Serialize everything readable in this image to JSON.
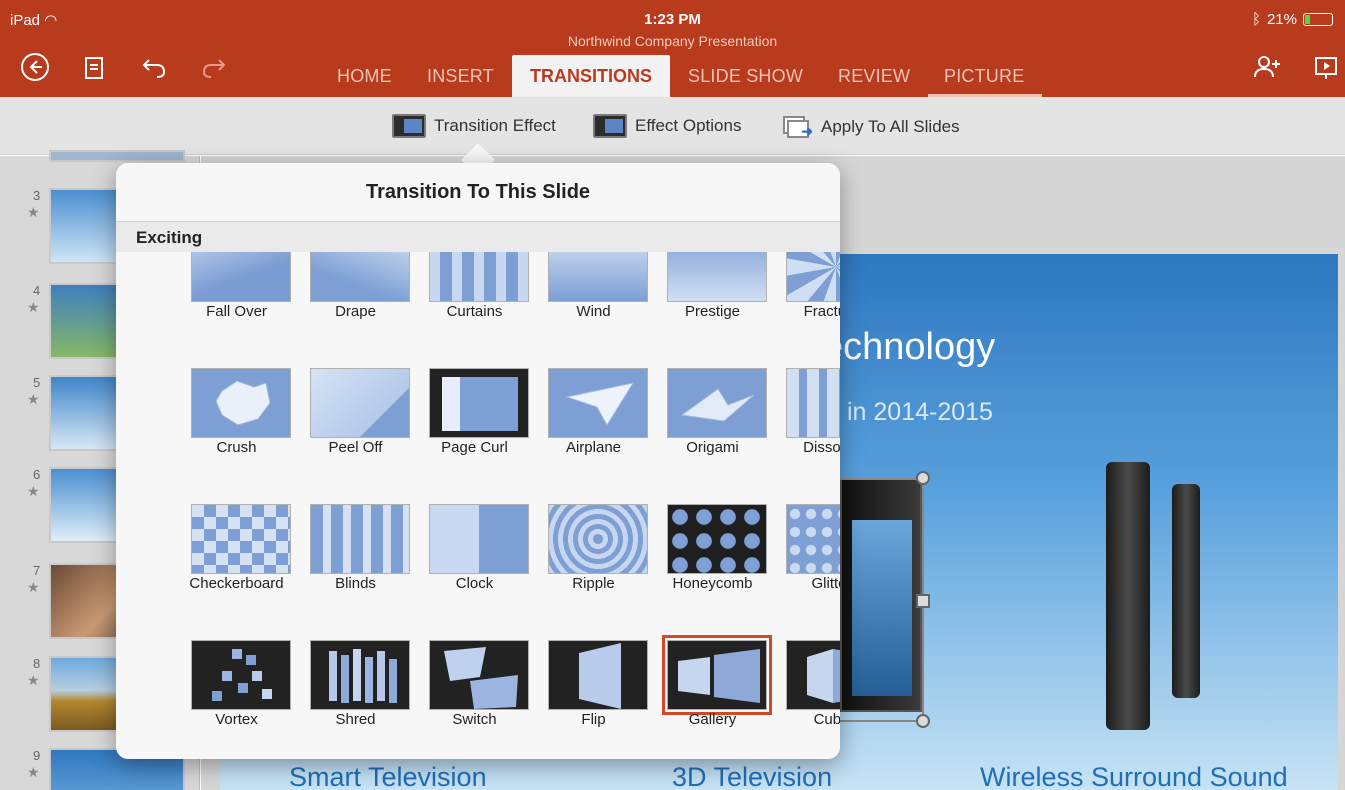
{
  "status": {
    "device": "iPad",
    "time": "1:23 PM",
    "battery": "21%",
    "battery_level": 0.21
  },
  "document": {
    "title": "Northwind Company Presentation"
  },
  "toolbar": {
    "back_icon": "back-circle-icon",
    "file_icon": "file-icon",
    "undo_icon": "undo-icon",
    "redo_icon": "redo-icon",
    "share_icon": "add-person-icon",
    "present_icon": "present-icon"
  },
  "tabs": [
    {
      "label": "HOME"
    },
    {
      "label": "INSERT"
    },
    {
      "label": "TRANSITIONS",
      "active": true
    },
    {
      "label": "SLIDE SHOW"
    },
    {
      "label": "REVIEW"
    },
    {
      "label": "PICTURE"
    }
  ],
  "ribbon": {
    "transition_effect": "Transition Effect",
    "effect_options": "Effect Options",
    "apply_all": "Apply To All Slides"
  },
  "slides": [
    {
      "number": "3"
    },
    {
      "number": "4"
    },
    {
      "number": "5"
    },
    {
      "number": "6"
    },
    {
      "number": "7"
    },
    {
      "number": "8"
    },
    {
      "number": "9"
    }
  ],
  "slide": {
    "title": "echnology",
    "subtitle": "in 2014-2015",
    "captions": [
      "Smart Television",
      "3D Television",
      "Wireless Surround Sound"
    ]
  },
  "popover": {
    "title": "Transition To This Slide",
    "section": "Exciting",
    "effects": [
      [
        "Fall Over",
        "Drape",
        "Curtains",
        "Wind",
        "Prestige",
        "Fracture"
      ],
      [
        "Crush",
        "Peel Off",
        "Page Curl",
        "Airplane",
        "Origami",
        "Dissolve"
      ],
      [
        "Checkerboard",
        "Blinds",
        "Clock",
        "Ripple",
        "Honeycomb",
        "Glitter"
      ],
      [
        "Vortex",
        "Shred",
        "Switch",
        "Flip",
        "Gallery",
        "Cube"
      ]
    ],
    "selected": "Gallery"
  },
  "colors": {
    "accent": "#B83B1E",
    "selection": "#D24A25"
  }
}
